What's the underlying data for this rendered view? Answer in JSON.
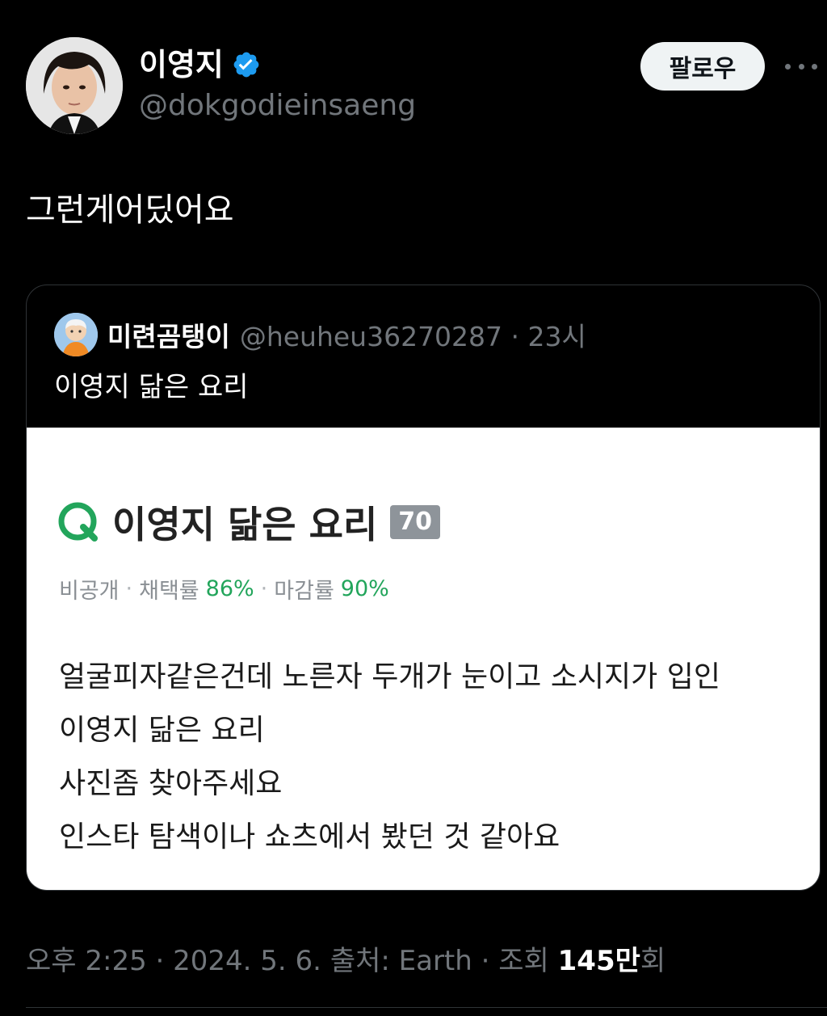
{
  "author": {
    "display_name": "이영지",
    "handle": "@dokgodieinsaeng",
    "verified_icon": "verified-badge-icon",
    "avatar": "avatar-photo"
  },
  "follow_button": {
    "label": "팔로우"
  },
  "more_icon": "more-horizontal-icon",
  "tweet": {
    "text": "그런게어딨어요"
  },
  "quote": {
    "author": {
      "display_name": "미련곰탱이",
      "handle": "@heuheu36270287",
      "separator": "·",
      "time": "23시"
    },
    "text": "이영지 닮은 요리",
    "image": {
      "title": "이영지 닮은 요리",
      "badge": "70",
      "meta": {
        "privacy": "비공개",
        "adopt_label": "채택률",
        "adopt_value": "86%",
        "close_label": "마감률",
        "close_value": "90%",
        "separator": "·"
      },
      "body_lines": [
        "얼굴피자같은건데 노른자 두개가 눈이고 소시지가 입인",
        "이영지 닮은 요리",
        "사진좀 찾아주세요",
        "인스타 탐색이나 쇼츠에서 봤던 것 같아요"
      ]
    }
  },
  "footer": {
    "time": "오후 2:25",
    "date": "2024. 5. 6.",
    "source": "출처: Earth",
    "views_label": "조회",
    "views_count": "145만",
    "views_suffix": "회",
    "separator": "·"
  },
  "colors": {
    "background": "#000000",
    "verified_blue": "#1d9bf0",
    "kin_green": "#22a55b",
    "muted": "#71767b"
  }
}
